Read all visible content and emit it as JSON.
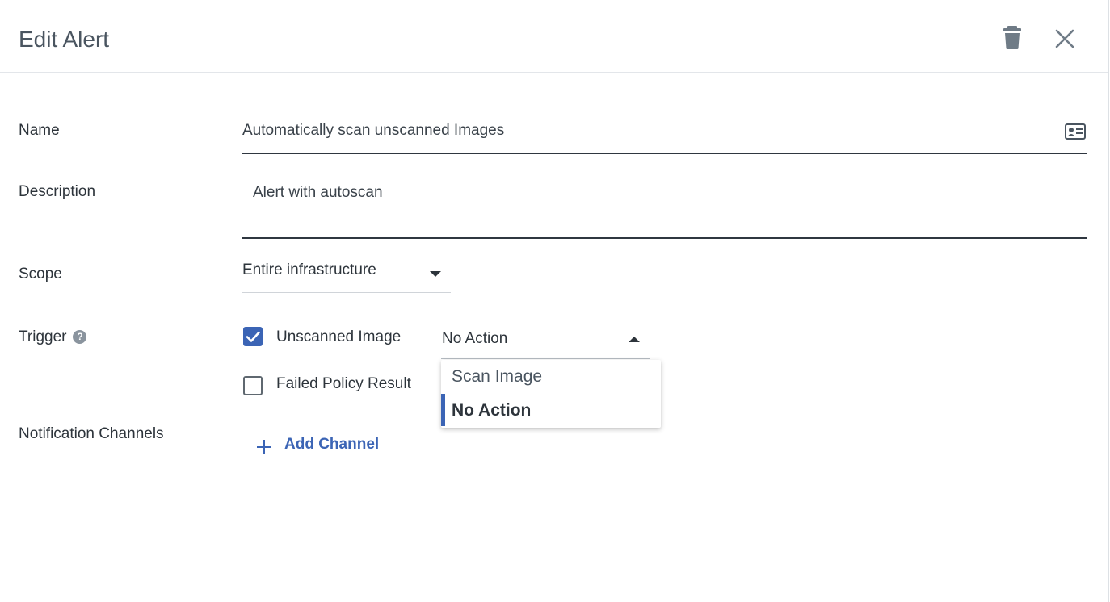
{
  "dialog": {
    "title": "Edit Alert",
    "delete_icon": "trash-icon",
    "close_icon": "close-icon"
  },
  "form": {
    "name": {
      "label": "Name",
      "value": "Automatically scan unscanned Images",
      "icon": "contact-card-icon"
    },
    "description": {
      "label": "Description",
      "value": "Alert with autoscan"
    },
    "scope": {
      "label": "Scope",
      "value": "Entire infrastructure"
    },
    "trigger": {
      "label": "Trigger",
      "help_icon": "help-icon",
      "help_glyph": "?",
      "options": [
        {
          "label": "Unscanned Image",
          "checked": true
        },
        {
          "label": "Failed Policy Result",
          "checked": false
        }
      ],
      "action": {
        "value": "No Action",
        "menu": [
          {
            "label": "Scan Image",
            "selected": false
          },
          {
            "label": "No Action",
            "selected": true
          }
        ]
      }
    },
    "notification_channels": {
      "label": "Notification Channels",
      "add_label": "Add Channel"
    }
  },
  "colors": {
    "accent": "#3b64b5",
    "text": "#2d343b",
    "icon_gray": "#6f7b86"
  }
}
